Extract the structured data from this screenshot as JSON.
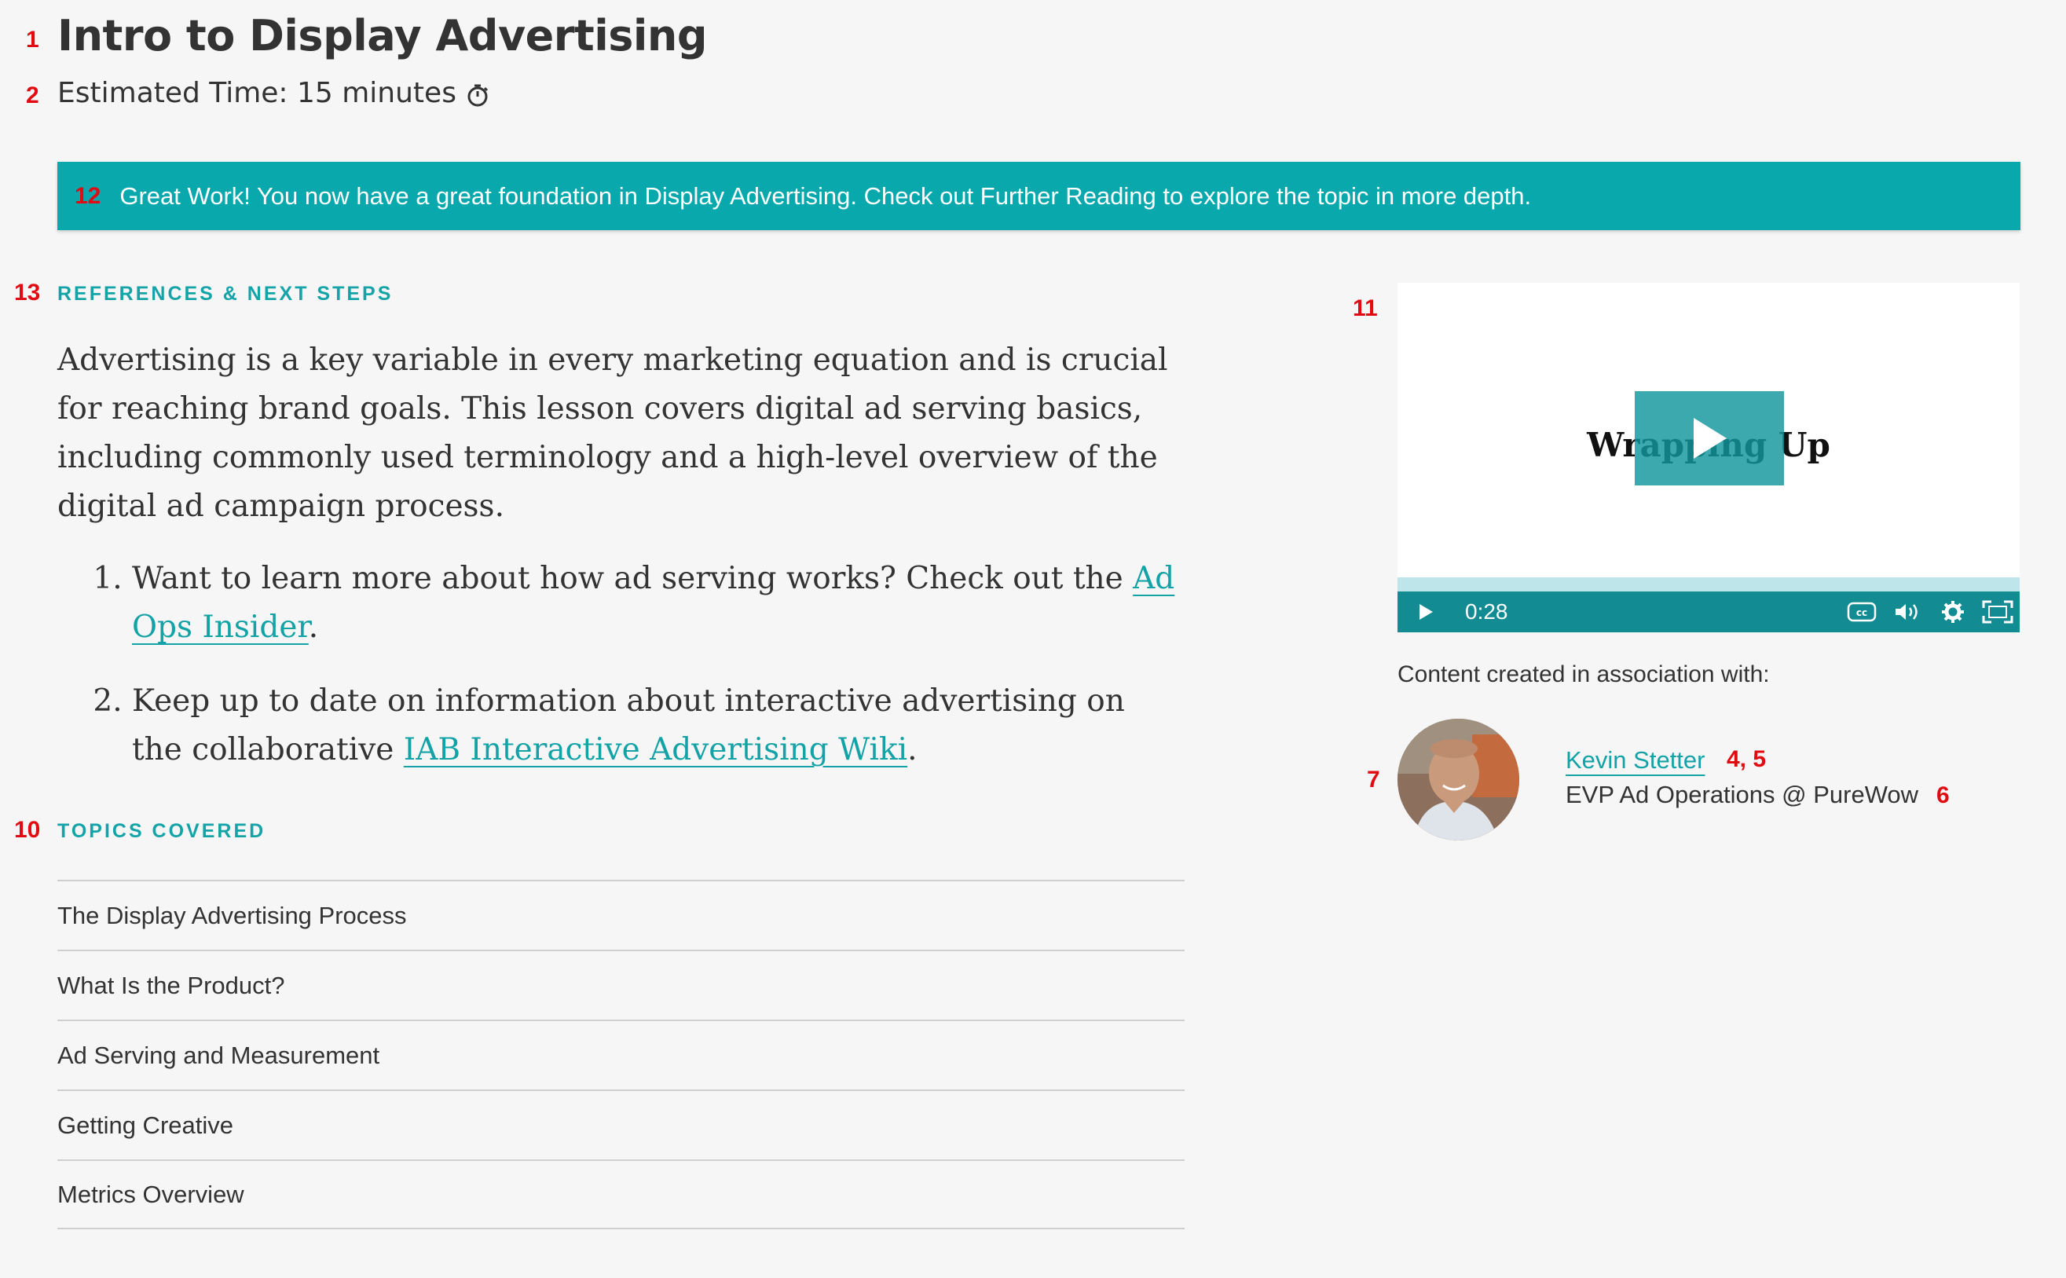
{
  "header": {
    "title": "Intro to Display Advertising",
    "estimated_time": "Estimated Time: 15 minutes",
    "clock_icon": "stopwatch-icon"
  },
  "markers": {
    "m1": "1",
    "m2": "2",
    "m12": "12",
    "m13": "13",
    "m10": "10",
    "m11": "11",
    "m7": "7",
    "m45": "4, 5",
    "m6": "6"
  },
  "banner": {
    "text": "Great Work! You now have a great foundation in Display Advertising. Check out Further Reading to explore the topic in more depth."
  },
  "references": {
    "heading": "REFERENCES & NEXT STEPS",
    "intro": "Advertising is a key variable in every marketing equation and is crucial for reaching brand goals. This lesson covers digital ad serving basics, including commonly used terminology and a high-level overview of the digital ad campaign process.",
    "items": [
      {
        "before": "Want to learn more about how ad serving works? Check out the ",
        "link": "Ad Ops Insider",
        "after": "."
      },
      {
        "before": "Keep up to date on information about interactive advertising on the collaborative ",
        "link": "IAB Interactive Advertising Wiki",
        "after": "."
      }
    ]
  },
  "topics": {
    "heading": "TOPICS COVERED",
    "items": [
      "The Display Advertising Process",
      "What Is the Product?",
      "Ad Serving and Measurement",
      "Getting Creative",
      "Metrics Overview"
    ]
  },
  "video": {
    "title": "Wrapping Up",
    "time": "0:28",
    "icons": [
      "play-icon",
      "captions-icon",
      "volume-icon",
      "settings-icon",
      "fullscreen-icon"
    ]
  },
  "author": {
    "assoc_label": "Content created in association with:",
    "name": "Kevin Stetter",
    "role": "EVP Ad Operations @ PureWow"
  },
  "colors": {
    "accent": "#08a8ac",
    "link": "#13a2a6",
    "marker": "#e10b12",
    "video_controls": "#128b93"
  }
}
